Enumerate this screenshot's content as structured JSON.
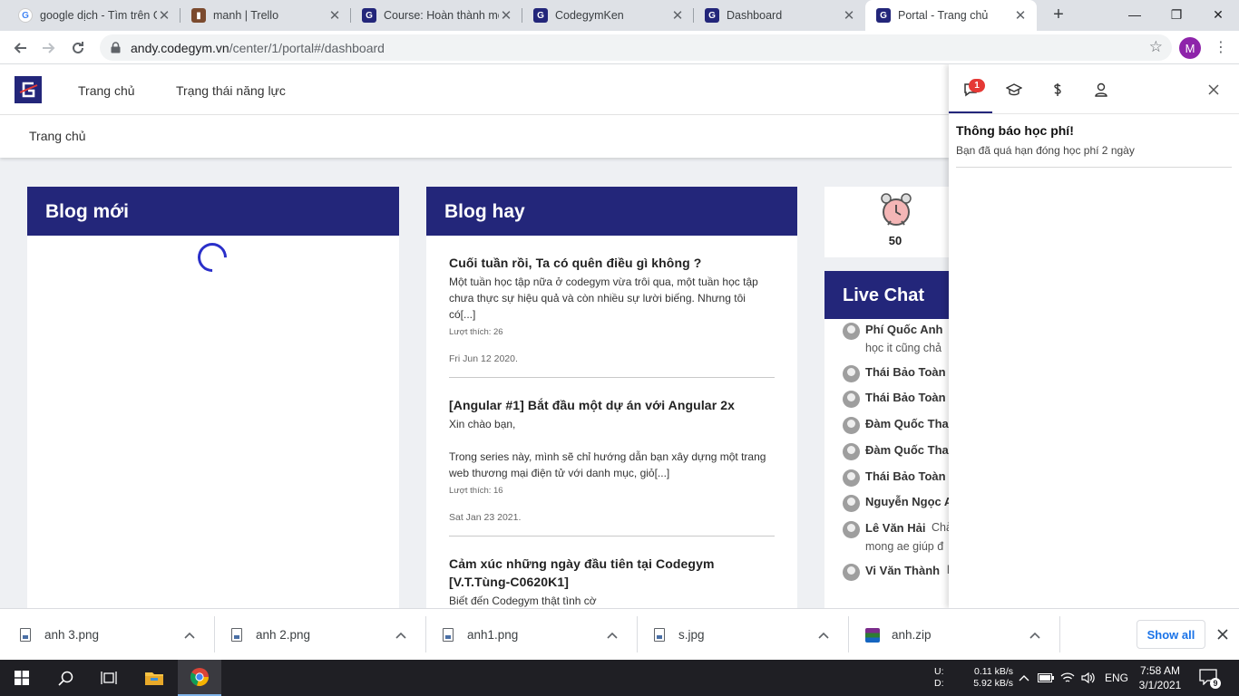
{
  "browser": {
    "tabs": [
      {
        "title": "google dịch - Tìm trên Google",
        "favicon": "google-g-icon"
      },
      {
        "title": "manh | Trello",
        "favicon": "trello-icon"
      },
      {
        "title": "Course: Hoàn thành mô-đun",
        "favicon": "codegym-icon"
      },
      {
        "title": "CodegymKen",
        "favicon": "codegym-icon"
      },
      {
        "title": "Dashboard",
        "favicon": "codegym-icon"
      },
      {
        "title": "Portal - Trang chủ",
        "favicon": "codegym-icon"
      }
    ],
    "active_tab": 5,
    "url_host": "andy.codegym.vn",
    "url_path": "/center/1/portal#/dashboard",
    "profile_initial": "M"
  },
  "site": {
    "nav": [
      "Trang chủ",
      "Trạng thái năng lực"
    ],
    "breadcrumb": "Trang chủ",
    "accent_color": "#23267a"
  },
  "blog_new": {
    "title": "Blog mới"
  },
  "blog_hot": {
    "title": "Blog hay",
    "posts": [
      {
        "title": "Cuối tuần rồi, Ta có quên điều gì không ?",
        "body": "Một tuần học tập nữa ở codegym vừa trôi qua, một tuần học tập chưa thực sự hiệu quả và còn nhiều sự lười biếng. Nhưng tôi có[...]",
        "likes": "Lượt thích: 26",
        "date": "Fri Jun 12 2020."
      },
      {
        "title": "[Angular #1] Bắt đầu một dự án với Angular 2x",
        "body": "Xin chào bạn,\n\nTrong series này, mình sẽ chỉ hướng dẫn bạn xây dựng một trang web thương mại điện tử với danh mục, giỏ[...]",
        "likes": "Lượt thích: 16",
        "date": "Sat Jan 23 2021."
      },
      {
        "title": "Cảm xúc những ngày đầu tiên tại Codegym [V.T.Tùng-C0620K1]",
        "body": "Biết đến Codegym thật tình cờ\nĐóng xong học phí, thấy đơ đơ\nChẳng biết hợp ko, nghĩ gõ phím?",
        "likes": "",
        "date": ""
      }
    ]
  },
  "alarm": {
    "value": "50"
  },
  "live_chat": {
    "title": "Live Chat",
    "messages": [
      {
        "name": "Phí Quốc Anh",
        "text": "học it cũng chả"
      },
      {
        "name": "Thái Bảo Toàn",
        "text": ""
      },
      {
        "name": "Thái Bảo Toàn",
        "text": ""
      },
      {
        "name": "Đàm Quốc Thanh",
        "text": ""
      },
      {
        "name": "Đàm Quốc Thanh",
        "text": ""
      },
      {
        "name": "Thái Bảo Toàn",
        "text": ""
      },
      {
        "name": "Nguyễn Ngọc Anh",
        "text": ""
      },
      {
        "name": "Lê Văn Hải",
        "text": "Chà",
        "text2": "mong ae giúp đ"
      },
      {
        "name": "Vi Văn Thành",
        "text": "l"
      }
    ]
  },
  "notification_panel": {
    "badge": "1",
    "tabs": [
      "chat-bubble-icon",
      "graduation-cap-icon",
      "dollar-icon",
      "user-icon"
    ],
    "item_title": "Thông báo học phí!",
    "item_body": "Bạn đã quá hạn đóng học phí 2 ngày"
  },
  "downloads": {
    "items": [
      "anh 3.png",
      "anh 2.png",
      "anh1.png",
      "s.jpg",
      "anh.zip"
    ],
    "show_all": "Show all"
  },
  "taskbar": {
    "net_labels": [
      "U:",
      "D:"
    ],
    "net_values": [
      "0.11 kB/s",
      "5.92 kB/s"
    ],
    "lang": "ENG",
    "time": "7:58 AM",
    "date": "3/1/2021",
    "notifications": "9"
  }
}
